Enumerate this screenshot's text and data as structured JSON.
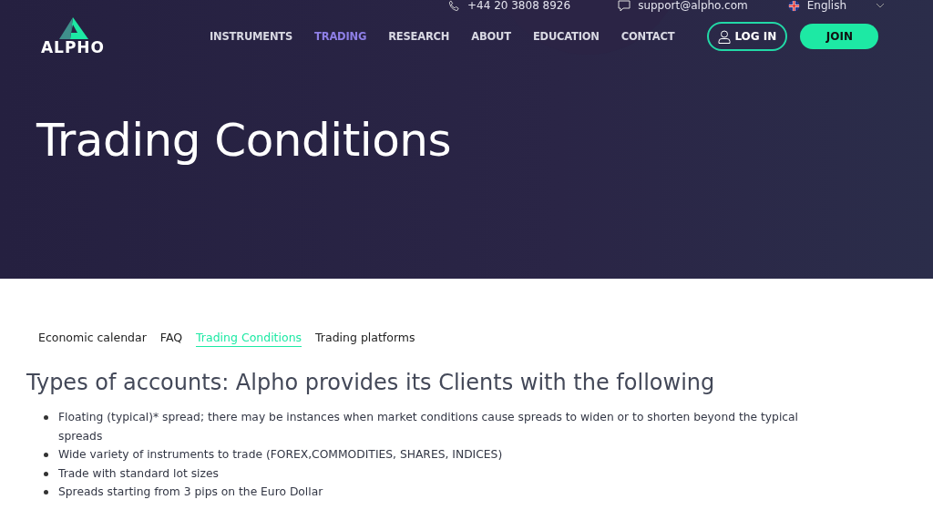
{
  "contact_bar": {
    "phone": "+44 20 3808 8926",
    "email": "support@alpho.com",
    "language": "English"
  },
  "logo": {
    "text": "ALPHO"
  },
  "nav": [
    {
      "label": "INSTRUMENTS",
      "selected": false
    },
    {
      "label": "TRADING",
      "selected": true
    },
    {
      "label": "RESEARCH",
      "selected": false
    },
    {
      "label": "ABOUT",
      "selected": false
    },
    {
      "label": "EDUCATION",
      "selected": false
    },
    {
      "label": "CONTACT",
      "selected": false
    }
  ],
  "buttons": {
    "login": "LOG IN",
    "join": "JOIN"
  },
  "hero": {
    "title": "Trading Conditions"
  },
  "subnav": [
    {
      "label": "Economic calendar",
      "selected": false
    },
    {
      "label": "FAQ",
      "selected": false
    },
    {
      "label": "Trading Conditions",
      "selected": true
    },
    {
      "label": "Trading platforms",
      "selected": false
    }
  ],
  "section": {
    "heading": "Types of accounts: Alpho provides its Clients with the following",
    "items": [
      "Floating (typical)* spread; there may be instances when market conditions cause spreads to widen or to shorten beyond the typical spreads",
      "Wide variety of instruments to trade (FOREX,COMMODITIES, SHARES, INDICES)",
      "Trade with standard lot sizes",
      "Spreads starting from 3 pips on the Euro Dollar"
    ]
  }
}
